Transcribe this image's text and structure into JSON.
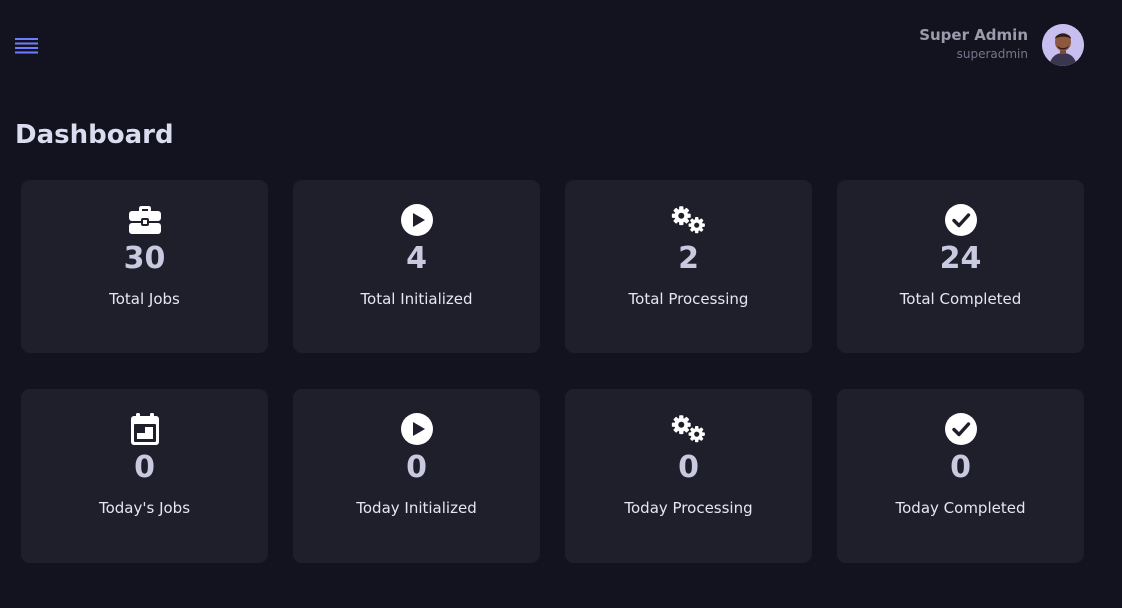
{
  "header": {
    "menu_icon": "hamburger-menu-icon",
    "user": {
      "name": "Super Admin",
      "username": "superadmin",
      "avatar_icon": "user-avatar-icon"
    }
  },
  "page": {
    "title": "Dashboard"
  },
  "colors": {
    "background": "#13131f",
    "card": "#1f1f2c",
    "accent": "#6f7cff",
    "value_text": "#c9c9e0"
  },
  "stats": [
    {
      "icon": "briefcase-icon",
      "value": "30",
      "label": "Total Jobs"
    },
    {
      "icon": "play-circle-icon",
      "value": "4",
      "label": "Total Initialized"
    },
    {
      "icon": "gears-icon",
      "value": "2",
      "label": "Total Processing"
    },
    {
      "icon": "check-circle-icon",
      "value": "24",
      "label": "Total Completed"
    },
    {
      "icon": "calendar-icon",
      "value": "0",
      "label": "Today's Jobs"
    },
    {
      "icon": "play-circle-icon",
      "value": "0",
      "label": "Today Initialized"
    },
    {
      "icon": "gears-icon",
      "value": "0",
      "label": "Today Processing"
    },
    {
      "icon": "check-circle-icon",
      "value": "0",
      "label": "Today Completed"
    }
  ]
}
